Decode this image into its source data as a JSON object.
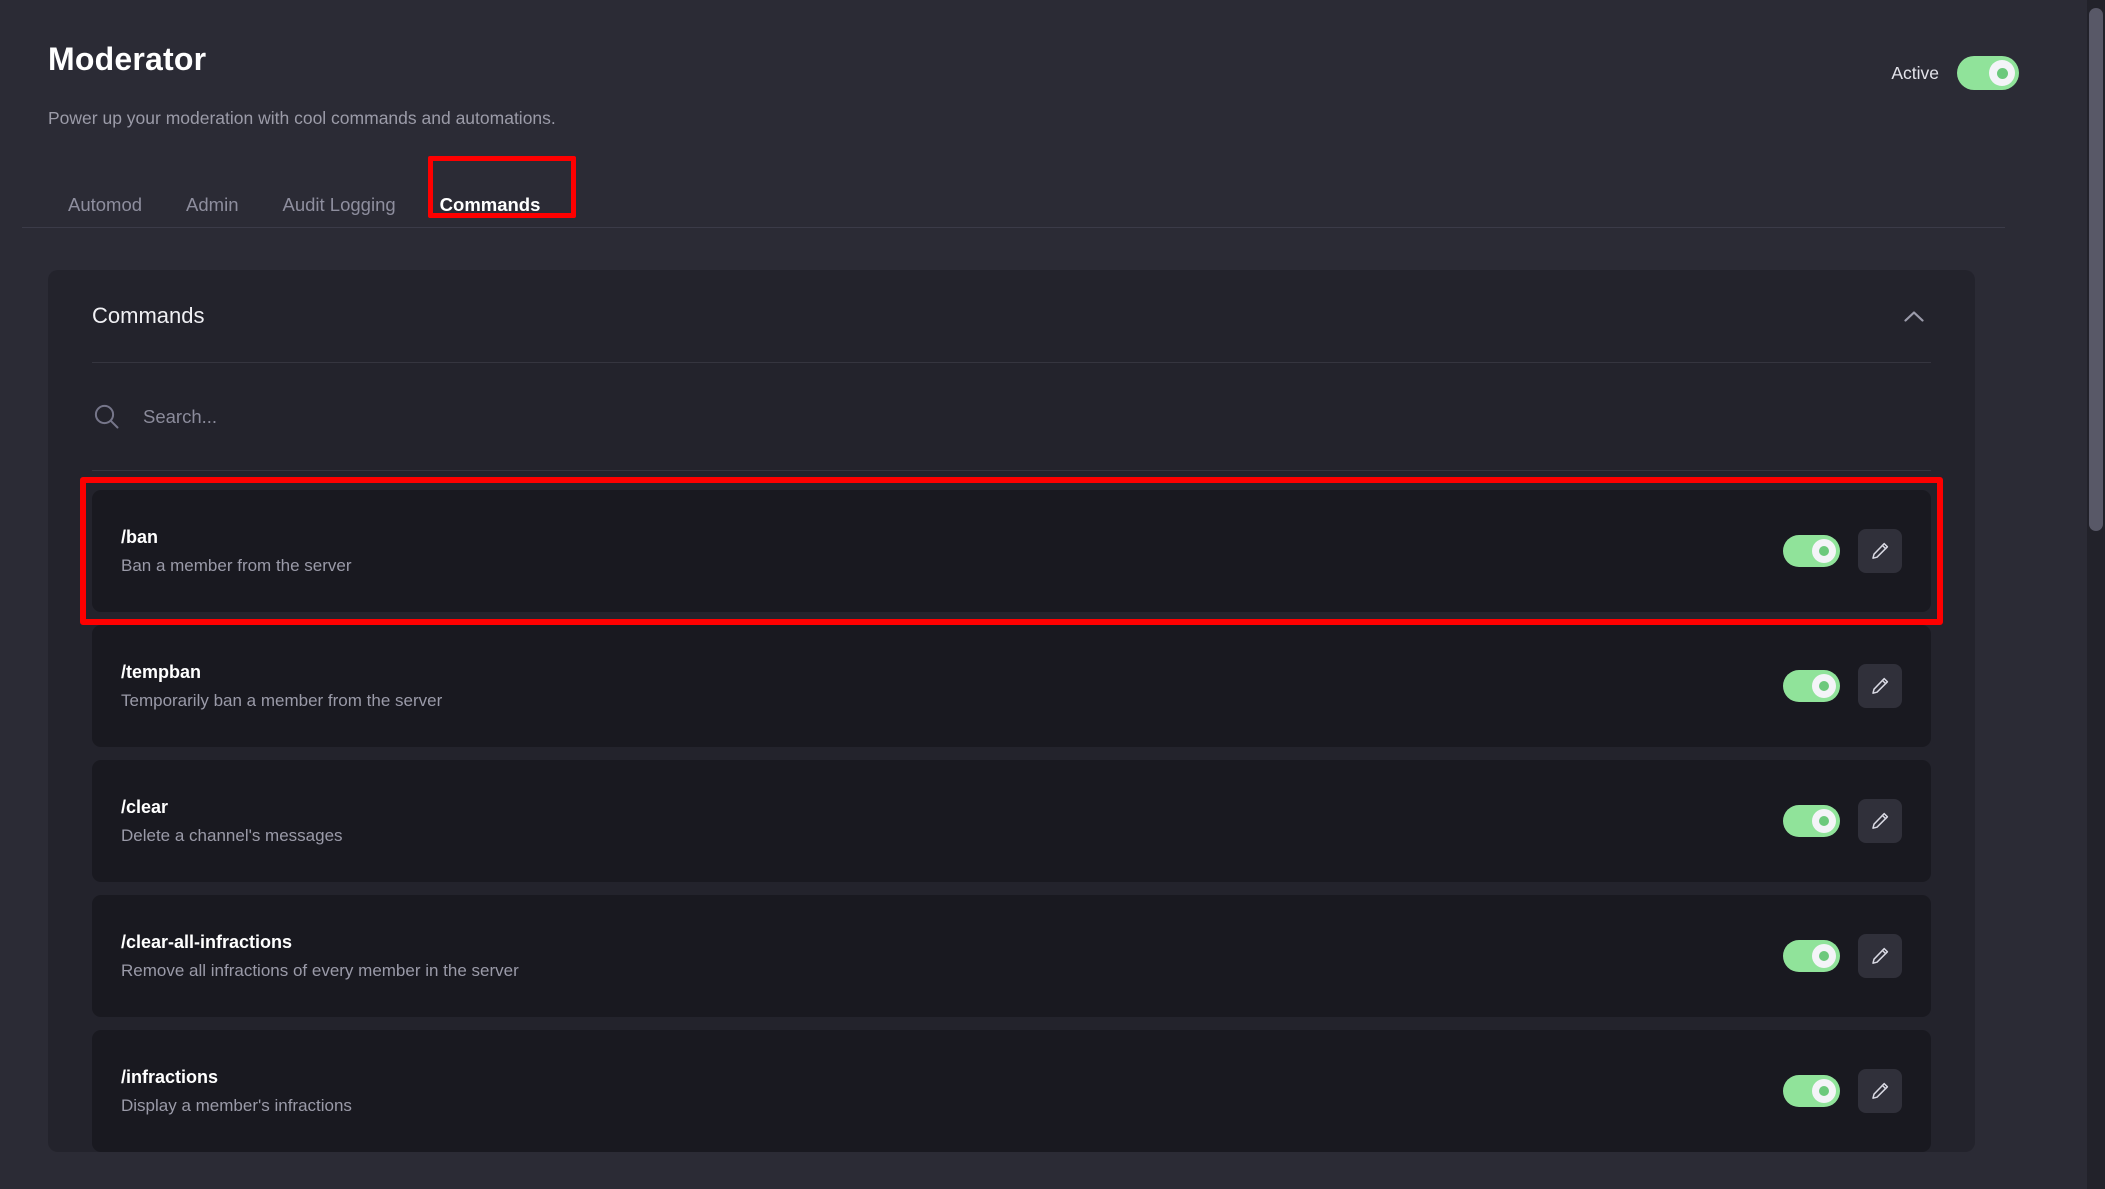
{
  "header": {
    "title": "Moderator",
    "subtitle": "Power up your moderation with cool commands and automations.",
    "active_label": "Active",
    "active_state": "on"
  },
  "tabs": [
    {
      "label": "Automod",
      "active": false
    },
    {
      "label": "Admin",
      "active": false
    },
    {
      "label": "Audit Logging",
      "active": false
    },
    {
      "label": "Commands",
      "active": true
    }
  ],
  "panel": {
    "title": "Commands",
    "collapse_icon": "chevron-up-icon",
    "expanded": true
  },
  "search": {
    "icon": "search-icon",
    "value": "",
    "placeholder": "Search..."
  },
  "commands": [
    {
      "name": "/ban",
      "description": "Ban a member from the server",
      "enabled": "on",
      "edit_icon": "pencil-icon",
      "highlighted": true
    },
    {
      "name": "/tempban",
      "description": "Temporarily ban a member from the server",
      "enabled": "on",
      "edit_icon": "pencil-icon",
      "highlighted": false
    },
    {
      "name": "/clear",
      "description": "Delete a channel's messages",
      "enabled": "on",
      "edit_icon": "pencil-icon",
      "highlighted": false
    },
    {
      "name": "/clear-all-infractions",
      "description": "Remove all infractions of every member in the server",
      "enabled": "on",
      "edit_icon": "pencil-icon",
      "highlighted": false
    },
    {
      "name": "/infractions",
      "description": "Display a member's infractions",
      "enabled": "on",
      "edit_icon": "pencil-icon",
      "highlighted": false
    }
  ],
  "colors": {
    "page_background": "#2b2b35",
    "panel_background": "#23232c",
    "row_background": "#191920",
    "toggle_on": "#90e39a",
    "annotation_red": "#fe0000",
    "text_primary": "#ffffff",
    "text_muted": "#9a9aa8"
  },
  "scrollbar": {
    "orientation": "vertical",
    "thumb_position": "top"
  }
}
